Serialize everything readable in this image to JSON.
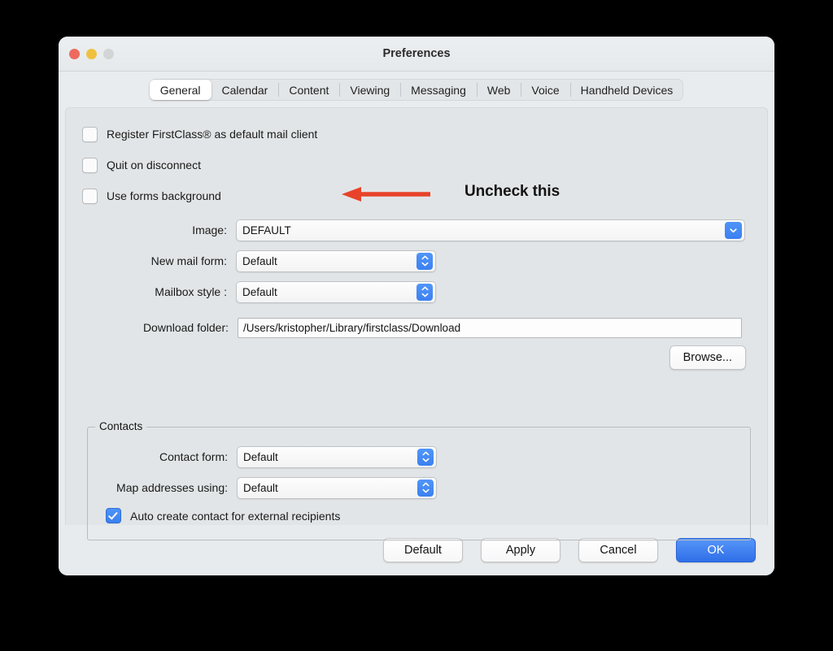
{
  "window": {
    "title": "Preferences",
    "traffic_lights": [
      "close-button",
      "minimize-button",
      "zoom-button"
    ]
  },
  "tabs": [
    {
      "label": "General",
      "active": true
    },
    {
      "label": "Calendar",
      "active": false
    },
    {
      "label": "Content",
      "active": false
    },
    {
      "label": "Viewing",
      "active": false
    },
    {
      "label": "Messaging",
      "active": false
    },
    {
      "label": "Web",
      "active": false
    },
    {
      "label": "Voice",
      "active": false
    },
    {
      "label": "Handheld Devices",
      "active": false
    }
  ],
  "general": {
    "checkboxes": [
      {
        "label": "Register FirstClass® as default mail client",
        "checked": false
      },
      {
        "label": "Quit on disconnect",
        "checked": false
      },
      {
        "label": "Use forms background",
        "checked": false
      }
    ],
    "image": {
      "label": "Image:",
      "value": "DEFAULT"
    },
    "new_mail_form": {
      "label": "New mail form:",
      "value": "Default"
    },
    "mailbox_style": {
      "label": "Mailbox style :",
      "value": "Default"
    },
    "download_folder": {
      "label": "Download folder:",
      "value": "/Users/kristopher/Library/firstclass/Download"
    },
    "browse_label": "Browse..."
  },
  "contacts": {
    "title": "Contacts",
    "contact_form": {
      "label": "Contact form:",
      "value": "Default"
    },
    "map_addresses": {
      "label": "Map addresses using:",
      "value": "Default"
    },
    "auto_create": {
      "label": "Auto create contact for external recipients",
      "checked": true
    }
  },
  "footer": {
    "default_label": "Default",
    "apply_label": "Apply",
    "cancel_label": "Cancel",
    "ok_label": "OK"
  },
  "annotation": {
    "text": "Uncheck this",
    "color": "#e8432a"
  },
  "colors": {
    "accent_blue": "#3b80f1",
    "primary_button": "#2f6fe8",
    "window_bg": "#e9ecee",
    "panel_bg": "#e2e5e7",
    "close_light": "#ed6a5e",
    "minimize_light": "#f0c040",
    "zoom_light": "#d2d4d5"
  }
}
